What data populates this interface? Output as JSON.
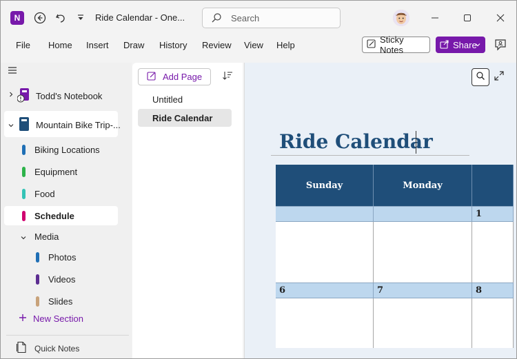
{
  "titlebar": {
    "app_logo": "N",
    "title": "Ride Calendar  -  One...",
    "search_placeholder": "Search",
    "icons": [
      "back-icon",
      "undo-icon",
      "customize-quick-access-icon",
      "minimize-icon",
      "maximize-icon",
      "close-icon"
    ]
  },
  "menu": {
    "items": [
      "File",
      "Home",
      "Insert",
      "Draw",
      "History",
      "Review",
      "View",
      "Help"
    ],
    "sticky_notes": "Sticky Notes",
    "share": "Share"
  },
  "sidebar": {
    "notebooks": [
      {
        "label": "Todd's Notebook",
        "expanded": false,
        "color": "#7719aa"
      },
      {
        "label": "Mountain Bike Trip-...",
        "expanded": true,
        "color": "#1f4e79"
      }
    ],
    "sections": [
      {
        "label": "Biking Locations",
        "color": "#1f6fb5"
      },
      {
        "label": "Equipment",
        "color": "#2db34a"
      },
      {
        "label": "Food",
        "color": "#34c3b6"
      },
      {
        "label": "Schedule",
        "color": "#d0006f",
        "selected": true
      }
    ],
    "group": {
      "label": "Media",
      "expanded": true
    },
    "group_sections": [
      {
        "label": "Photos",
        "color": "#1f6fb5"
      },
      {
        "label": "Videos",
        "color": "#5c2d91"
      },
      {
        "label": "Slides",
        "color": "#c8a27a"
      }
    ],
    "new_section": "New Section",
    "quick_notes": "Quick Notes"
  },
  "pagelist": {
    "add_page": "Add Page",
    "pages": [
      {
        "label": "Untitled",
        "selected": false
      },
      {
        "label": "Ride Calendar",
        "selected": true
      }
    ]
  },
  "canvas": {
    "page_title": "Ride Calendar",
    "calendar": {
      "days": [
        "Sunday",
        "Monday",
        ""
      ],
      "week1_dates": [
        "",
        "",
        "1"
      ],
      "week2_dates": [
        "6",
        "7",
        "8"
      ]
    }
  },
  "colors": {
    "accent": "#7719aa",
    "calendar_header": "#1f4e79",
    "calendar_daterow": "#bdd7ee"
  }
}
